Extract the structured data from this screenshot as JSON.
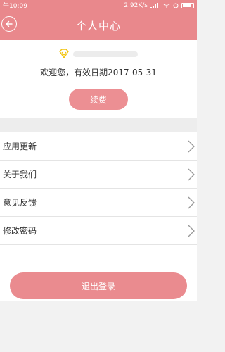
{
  "status_bar": {
    "time": "午10:09",
    "network_speed": "2.92K/s"
  },
  "header": {
    "title": "个人中心"
  },
  "profile": {
    "welcome_text": "欢迎您，有效日期2017-05-31",
    "renew_label": "续费"
  },
  "menu": {
    "items": [
      {
        "label": "应用更新"
      },
      {
        "label": "关于我们"
      },
      {
        "label": "意见反馈"
      },
      {
        "label": "修改密码"
      }
    ]
  },
  "logout_label": "退出登录",
  "colors": {
    "brand": "#e9888c",
    "button": "#ec8f93"
  }
}
